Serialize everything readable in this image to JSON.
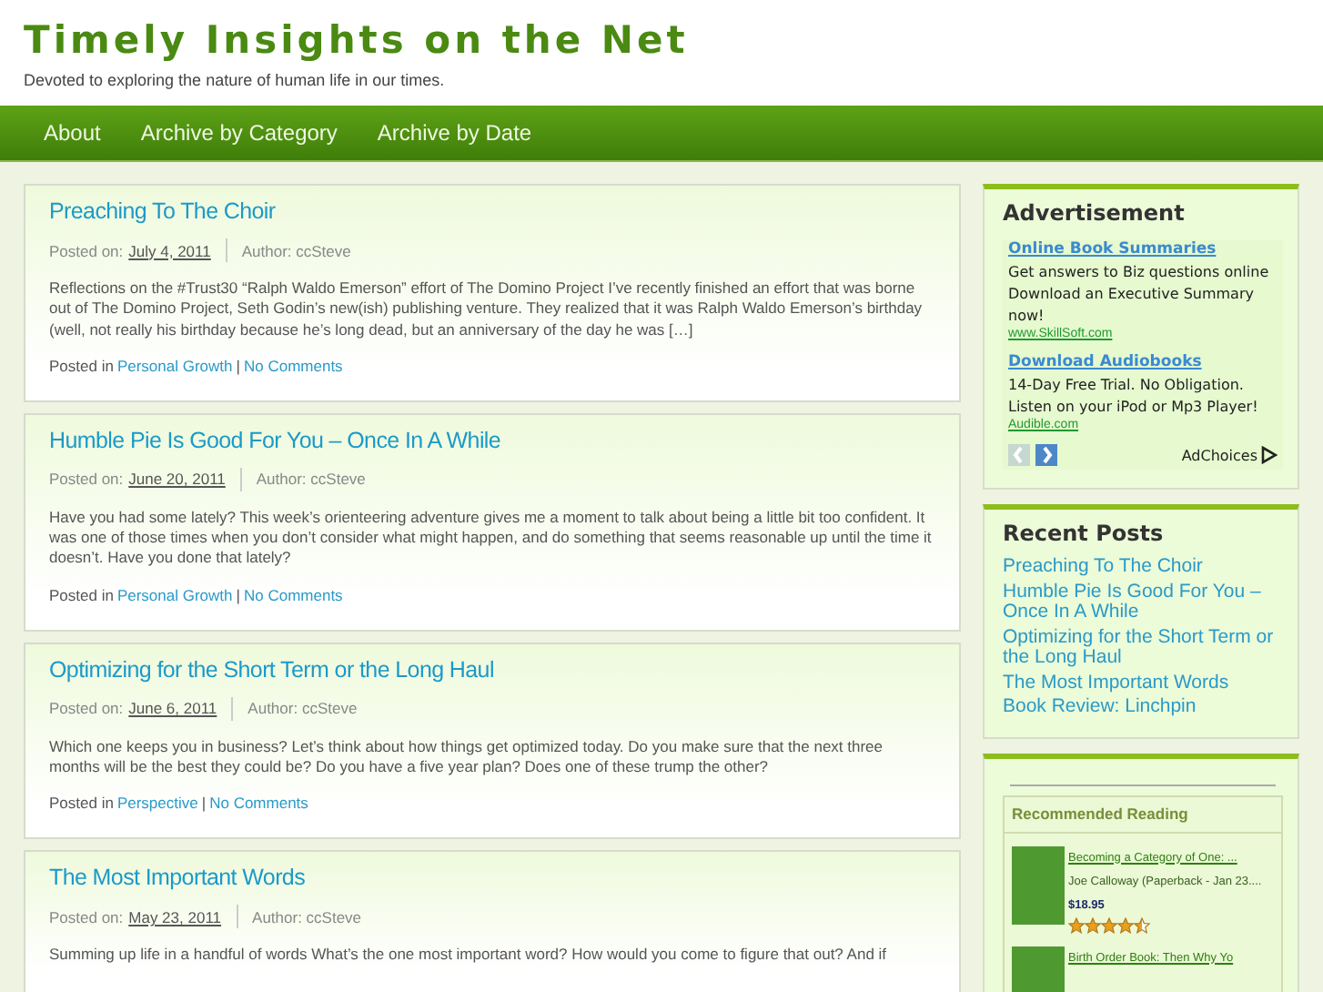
{
  "site": {
    "title": "Timely Insights on the Net",
    "tagline": "Devoted to exploring the nature of human life in our times."
  },
  "nav": [
    {
      "label": "About"
    },
    {
      "label": "Archive by Category"
    },
    {
      "label": "Archive by Date"
    }
  ],
  "posts": [
    {
      "title": "Preaching To The Choir",
      "posted_label": "Posted on:",
      "date": "July 4, 2011",
      "author": "Author: ccSteve",
      "excerpt": "Reflections on the #Trust30 “Ralph Waldo Emerson” effort of The Domino Project I’ve recently finished an effort that was borne out of The Domino Project, Seth Godin’s new(ish) publishing venture. They realized that it was Ralph Waldo Emerson’s birthday (well, not really his birthday because he’s long dead, but an anniversary of the day he was […]",
      "posted_in": "Posted in",
      "category": "Personal Growth",
      "separator": "|",
      "comments": "No Comments"
    },
    {
      "title": "Humble Pie Is Good For You – Once In A While",
      "posted_label": "Posted on:",
      "date": "June 20, 2011",
      "author": "Author: ccSteve",
      "excerpt": "Have you had some lately? This week’s orienteering adventure gives me a moment to talk about being a little bit too confident. It was one of those times when you don’t consider what might happen, and do something that seems reasonable up until the time it doesn’t. Have you done that lately?",
      "posted_in": "Posted in",
      "category": "Personal Growth",
      "separator": "|",
      "comments": "No Comments"
    },
    {
      "title": "Optimizing for the Short Term or the Long Haul",
      "posted_label": "Posted on:",
      "date": "June 6, 2011",
      "author": "Author: ccSteve",
      "excerpt": "Which one keeps you in business? Let’s think about how things get optimized today. Do you make sure that the next three months will be the best they could be? Do you have a five year plan? Does one of these trump the other?",
      "posted_in": "Posted in",
      "category": "Perspective",
      "separator": "|",
      "comments": "No Comments"
    },
    {
      "title": "The Most Important Words",
      "posted_label": "Posted on:",
      "date": "May 23, 2011",
      "author": "Author: ccSteve",
      "excerpt": "Summing up life in a handful of words What’s the one most important word? How would you come to figure that out? And if"
    }
  ],
  "advertisement": {
    "heading": "Advertisement",
    "ads": [
      {
        "title": "Online Book Summaries",
        "text": "Get answers to Biz questions online Download an Executive Summary now!",
        "url": "www.SkillSoft.com"
      },
      {
        "title": "Download Audiobooks",
        "text": "14-Day Free Trial. No Obligation. Listen on your iPod or Mp3 Player!",
        "url": "Audible.com"
      }
    ],
    "nav": [
      {
        "kind": "prev",
        "disabled": true
      },
      {
        "kind": "next",
        "disabled": false
      }
    ],
    "adchoices": "AdChoices"
  },
  "recent_posts": {
    "heading": "Recent Posts",
    "items": [
      "Preaching To The Choir",
      "Humble Pie Is Good For You – Once In A While",
      "Optimizing for the Short Term or the Long Haul",
      "The Most Important Words",
      "Book Review: Linchpin"
    ]
  },
  "recommended": {
    "heading": "Recommended Reading",
    "items": [
      {
        "title": "Becoming a Category of One: ...",
        "author": "Joe Calloway (Paperback - Jan 23....",
        "price": "$18.95",
        "stars": 4.5
      },
      {
        "title": "Birth Order Book: Then Why Yo"
      }
    ]
  }
}
